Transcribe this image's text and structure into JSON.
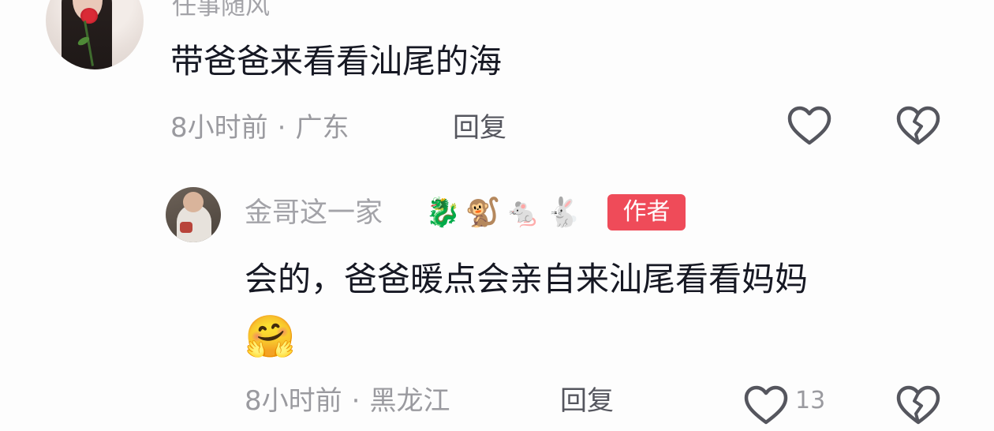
{
  "top_comment": {
    "username": "任事随风",
    "content": "带爸爸来看看汕尾的海",
    "time": "8小时前",
    "separator": "·",
    "location": "广东",
    "reply_label": "回复",
    "like_icon": "heart-outline-icon",
    "dislike_icon": "broken-heart-icon"
  },
  "reply_comment": {
    "username": "金哥这一家",
    "username_emojis": "🐉🐒🐁🐇",
    "badge": "作者",
    "badge_color": "#ef4b59",
    "content": "会的，爸爸暖点会亲自来汕尾看看妈妈",
    "content_emoji": "🤗",
    "time": "8小时前",
    "separator": "·",
    "location": "黑龙江",
    "reply_label": "回复",
    "like_count": "13",
    "like_icon": "heart-outline-icon",
    "dislike_icon": "broken-heart-icon"
  },
  "colors": {
    "text_primary": "#161823",
    "text_secondary": "#9a9a9f",
    "reply_text": "#55565e",
    "background": "#fdfdfd"
  }
}
